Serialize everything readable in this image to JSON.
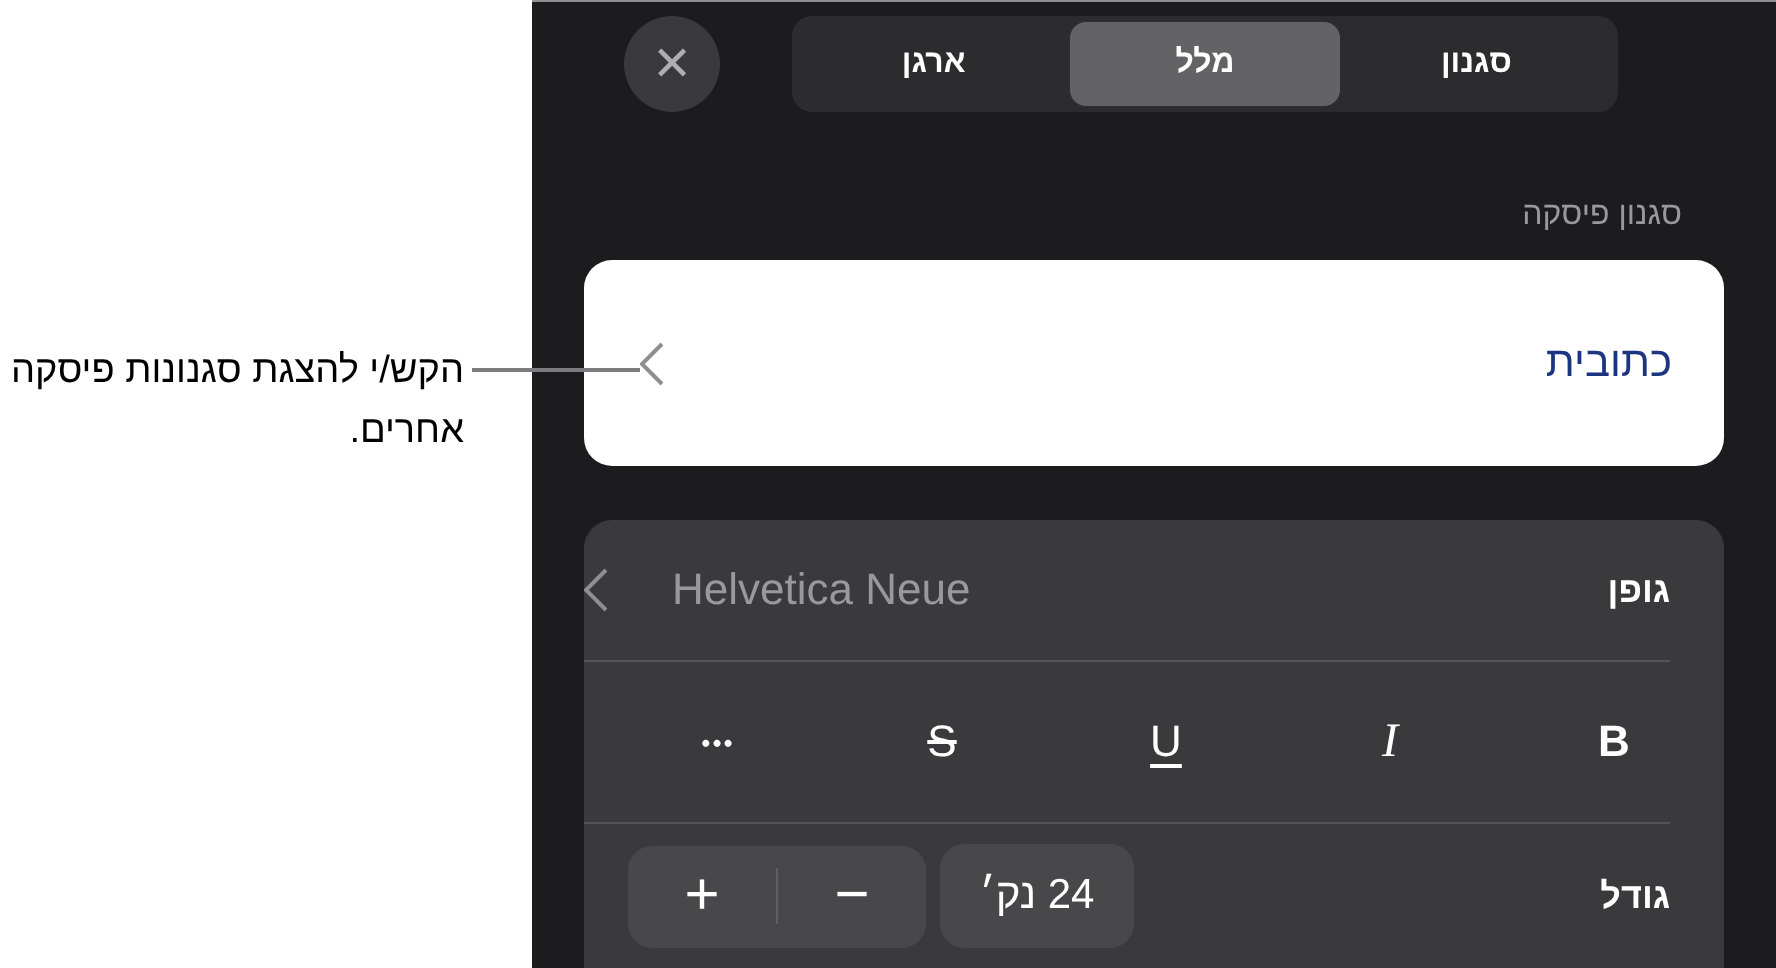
{
  "callout": {
    "text": "הקש/י להצגת סגנונות פיסקה אחרים."
  },
  "close_button": {
    "label": "✕"
  },
  "tabs": [
    {
      "label": "סגנון",
      "selected": false
    },
    {
      "label": "מלל",
      "selected": true
    },
    {
      "label": "ארגן",
      "selected": false
    }
  ],
  "paragraph_style": {
    "heading": "סגנון פיסקה",
    "value": "כתובית"
  },
  "font": {
    "label": "גופן",
    "value": "Helvetica Neue"
  },
  "format_buttons": [
    {
      "kind": "bold",
      "label": "B"
    },
    {
      "kind": "italic",
      "label": "I"
    },
    {
      "kind": "underline",
      "label": "U"
    },
    {
      "kind": "strikethrough",
      "label": "S"
    },
    {
      "kind": "more",
      "label": "•••"
    }
  ],
  "size": {
    "label": "גודל",
    "value": "24 נק׳",
    "increase": "+",
    "decrease": "−"
  }
}
